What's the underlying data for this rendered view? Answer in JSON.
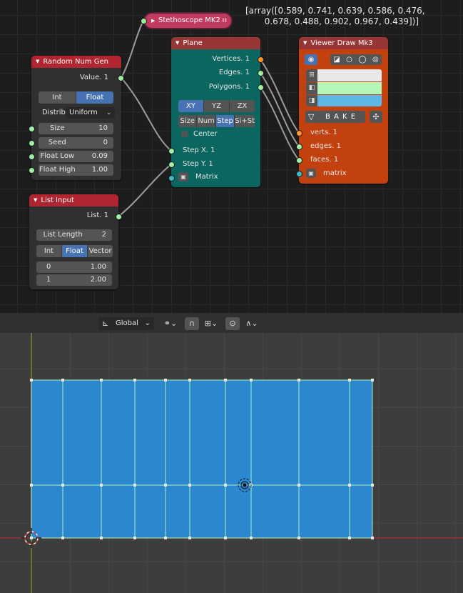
{
  "console_output": {
    "line1": "[array([0.589, 0.741, 0.639, 0.586, 0.476,",
    "line2": "       0.678, 0.488, 0.902, 0.967, 0.439])]"
  },
  "stethoscope": {
    "title": "Stethoscope MK2",
    "pause_icon": "ıı"
  },
  "random_num_gen": {
    "title": "Random Num Gen",
    "output": "Value. 1",
    "mode_int": "Int",
    "mode_float": "Float",
    "distrib_label": "Distrib",
    "distrib_value": "Uniform",
    "size_label": "Size",
    "size_value": "10",
    "seed_label": "Seed",
    "seed_value": "0",
    "low_label": "Float Low",
    "low_value": "0.09",
    "high_label": "Float High",
    "high_value": "1.00"
  },
  "list_input": {
    "title": "List Input",
    "output": "List. 1",
    "length_label": "List Length",
    "length_value": "2",
    "mode_int": "Int",
    "mode_float": "Float",
    "mode_vector": "Vector",
    "items": [
      {
        "index": "0",
        "value": "1.00"
      },
      {
        "index": "1",
        "value": "2.00"
      }
    ]
  },
  "plane": {
    "title": "Plane",
    "out_vertices": "Vertices. 1",
    "out_edges": "Edges. 1",
    "out_polygons": "Polygons. 1",
    "dir_xy": "XY",
    "dir_yz": "YZ",
    "dir_zx": "ZX",
    "mode_size": "Size",
    "mode_num": "Num",
    "mode_step": "Step",
    "mode_sist": "Si+St",
    "center_label": "Center",
    "in_step_x": "Step X. 1",
    "in_step_y": "Step Y. 1",
    "in_matrix": "Matrix"
  },
  "viewer_draw": {
    "title": "Viewer Draw Mk3",
    "bake_label": "B A K E",
    "in_verts": "verts. 1",
    "in_edges": "edges. 1",
    "in_faces": "faces. 1",
    "in_matrix": "matrix",
    "colors": {
      "verts": "#e8e8e8",
      "edges": "#b4f5b8",
      "faces": "#5eb6e6"
    }
  },
  "viewport_header": {
    "orientation": "Global"
  },
  "colors": {
    "face": "#2a87d0",
    "wire": "#aef0b8",
    "x_axis": "#9a3236",
    "y_axis": "#6b8a2a"
  }
}
